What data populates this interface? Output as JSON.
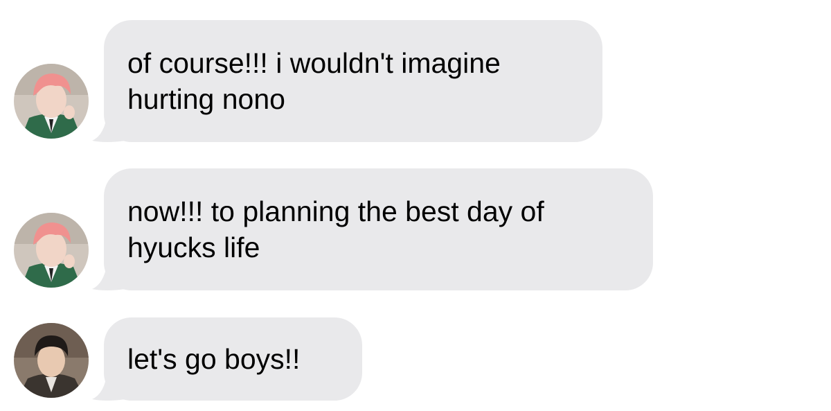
{
  "messages": [
    {
      "sender_avatar": "pink-hair-boy-avatar",
      "lines": [
        "of course!!! i wouldn't imagine",
        "hurting nono"
      ]
    },
    {
      "sender_avatar": "pink-hair-boy-avatar",
      "lines": [
        "now!!! to planning the best day of",
        "hyucks life"
      ]
    },
    {
      "sender_avatar": "dark-hair-boy-avatar",
      "lines": [
        "let's go boys!!"
      ]
    }
  ],
  "colors": {
    "bubble": "#e9e9eb",
    "text": "#000000",
    "background": "#ffffff"
  }
}
